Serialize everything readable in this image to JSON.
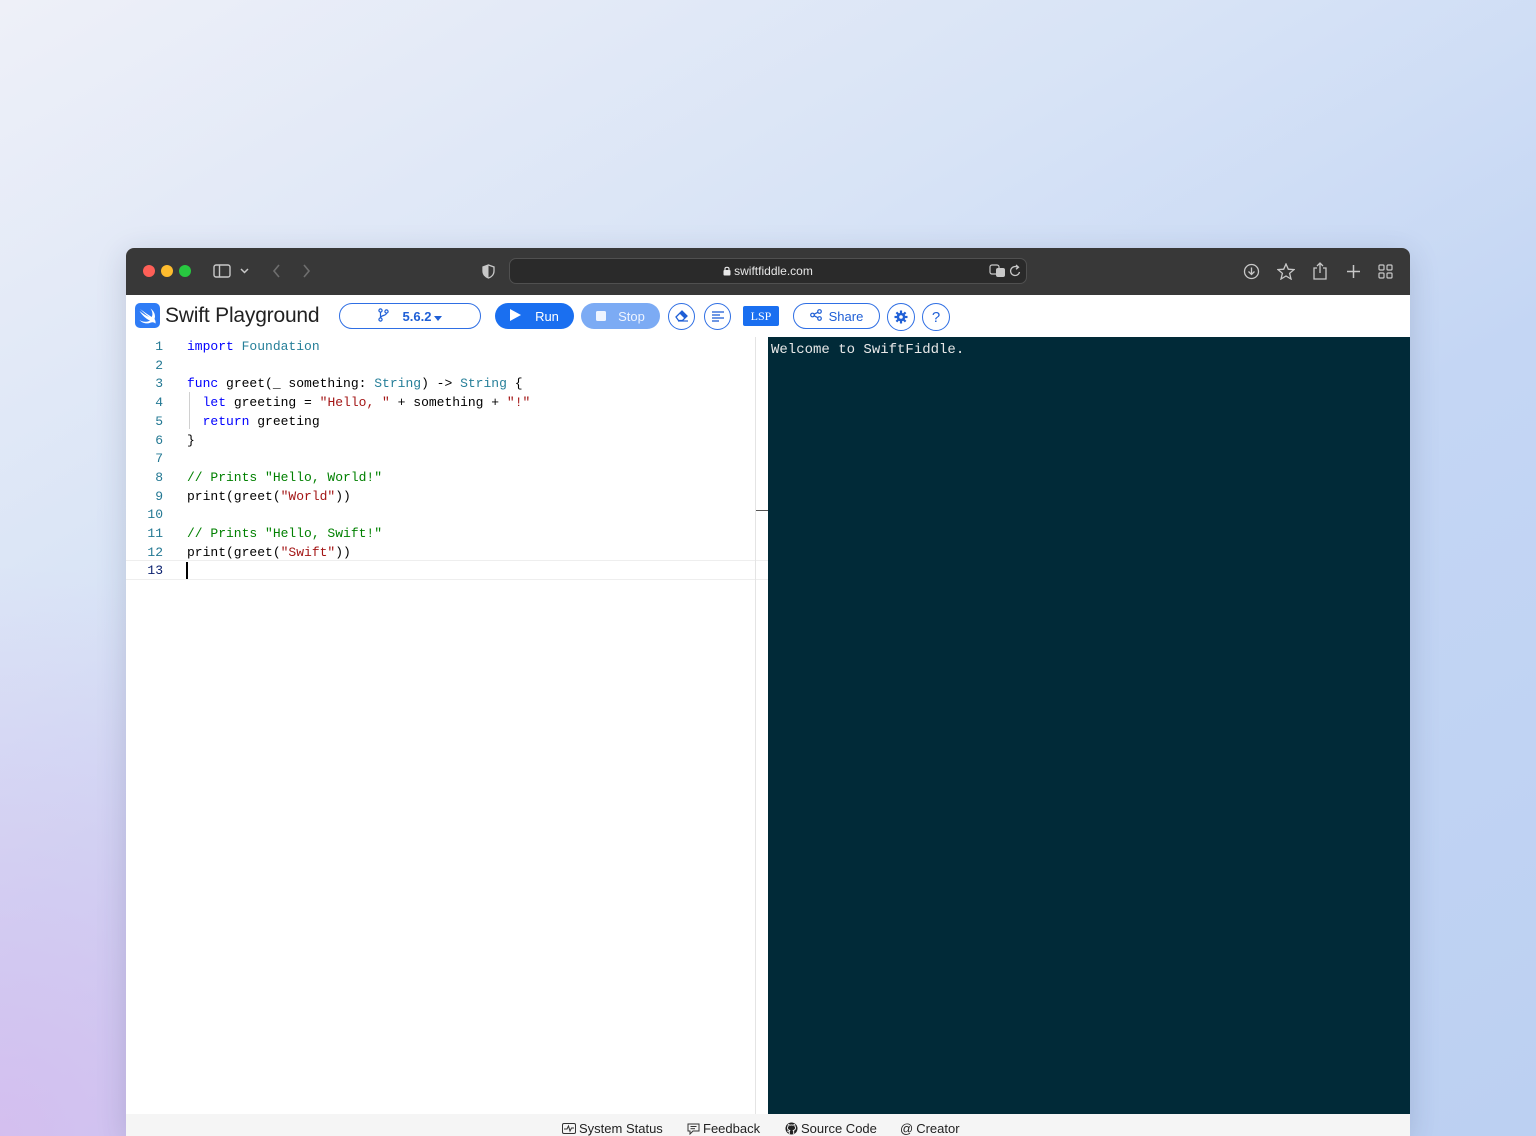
{
  "browser": {
    "url": "swiftfiddle.com",
    "icons": [
      "sidebar-icon",
      "chevron-down-icon",
      "back-icon",
      "forward-icon",
      "shield-icon",
      "lock-icon",
      "translate-icon",
      "reload-icon",
      "download-icon",
      "star-icon",
      "share-icon",
      "plus-icon",
      "tabs-grid-icon"
    ]
  },
  "app": {
    "title": "Swift Playground",
    "version_label": "5.6.2",
    "run_label": "Run",
    "stop_label": "Stop",
    "lsp_label": "LSP",
    "share_label": "Share",
    "help_label": "?",
    "accent_color": "#1a6ff0"
  },
  "editor": {
    "line_numbers": [
      "1",
      "2",
      "3",
      "4",
      "5",
      "6",
      "7",
      "8",
      "9",
      "10",
      "11",
      "12",
      "13"
    ],
    "lines": [
      [
        {
          "t": "import",
          "c": "kw"
        },
        {
          "t": " "
        },
        {
          "t": "Foundation",
          "c": "ty"
        }
      ],
      [],
      [
        {
          "t": "func",
          "c": "kw"
        },
        {
          "t": " greet(_ something: "
        },
        {
          "t": "String",
          "c": "ty"
        },
        {
          "t": ") -> "
        },
        {
          "t": "String",
          "c": "ty"
        },
        {
          "t": " {"
        }
      ],
      [
        {
          "t": "  "
        },
        {
          "t": "let",
          "c": "kw"
        },
        {
          "t": " greeting = "
        },
        {
          "t": "\"Hello, \"",
          "c": "st"
        },
        {
          "t": " + something + "
        },
        {
          "t": "\"!\"",
          "c": "st"
        }
      ],
      [
        {
          "t": "  "
        },
        {
          "t": "return",
          "c": "kw"
        },
        {
          "t": " greeting"
        }
      ],
      [
        {
          "t": "}"
        }
      ],
      [],
      [
        {
          "t": "// Prints \"Hello, World!\"",
          "c": "cm"
        }
      ],
      [
        {
          "t": "print(greet("
        },
        {
          "t": "\"World\"",
          "c": "st"
        },
        {
          "t": "))"
        }
      ],
      [],
      [
        {
          "t": "// Prints \"Hello, Swift!\"",
          "c": "cm"
        }
      ],
      [
        {
          "t": "print(greet("
        },
        {
          "t": "\"Swift\"",
          "c": "st"
        },
        {
          "t": "))"
        }
      ],
      []
    ],
    "current_line": 13
  },
  "console": {
    "output": "Welcome to SwiftFiddle."
  },
  "footer": {
    "links": [
      {
        "label": "System Status",
        "icon": "activity-icon"
      },
      {
        "label": "Feedback",
        "icon": "comment-icon"
      },
      {
        "label": "Source Code",
        "icon": "github-icon"
      },
      {
        "label": "Creator",
        "icon": "at-icon"
      }
    ]
  }
}
